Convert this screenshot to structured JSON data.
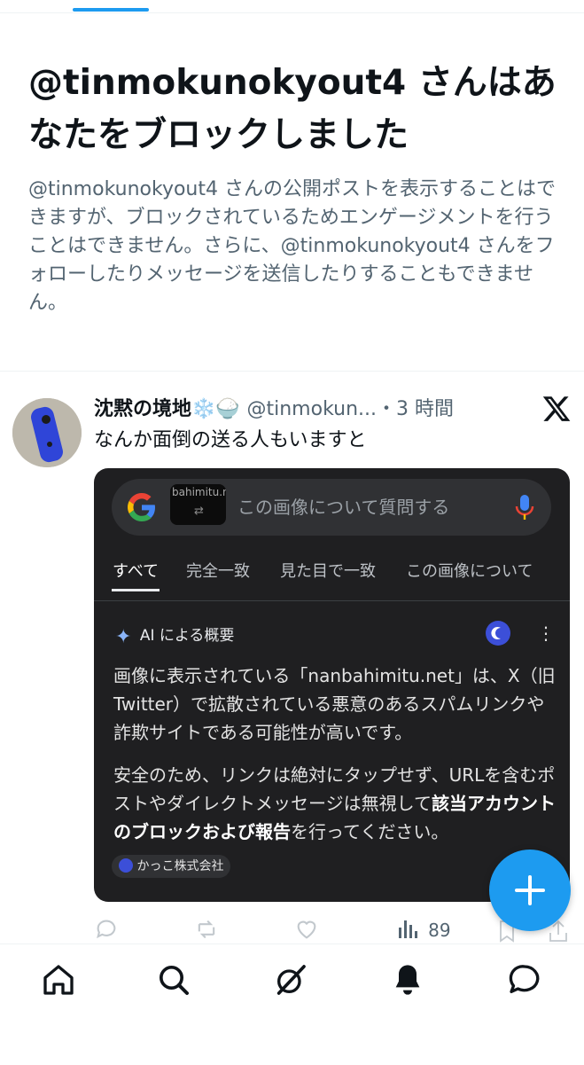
{
  "block_notice": {
    "title": "@tinmokunokyout4 さんはあなたをブロックしました",
    "description": "@tinmokunokyout4 さんの公開ポストを表示することはできますが、ブロックされているためエンゲージメントを行うことはできません。さらに、@tinmokunokyout4 さんをフォローしたりメッセージを送信したりすることもできません。"
  },
  "post": {
    "display_name": "沈黙の境地",
    "handle": "@tinmokun...",
    "time": "・3 時間",
    "text": "なんか面倒の送る人もいますと",
    "stats": {
      "views": "89"
    }
  },
  "google_card": {
    "thumbnail_text": "bahimitu.ne",
    "search_placeholder": "この画像について質問する",
    "tabs": [
      {
        "label": "すべて",
        "active": true
      },
      {
        "label": "完全一致",
        "active": false
      },
      {
        "label": "見た目で一致",
        "active": false
      },
      {
        "label": "この画像について",
        "active": false
      }
    ],
    "ai_overview_label": "AI による概要",
    "paragraph1": "画像に表示されている「nanbahimitu.net」は、X（旧Twitter）で拡散されている悪意のあるスパムリンクや詐欺サイトである可能性が高いです。",
    "paragraph2_start": "安全のため、リンクは絶対にタップせず、URLを含むポストやダイレクトメッセージは無視して",
    "paragraph2_bold": "該当アカウントのブロックおよび報告",
    "paragraph2_end": "を行ってください。",
    "source_chip": "かっこ株式会社"
  },
  "colors": {
    "accent": "#1d9bf0",
    "card_bg": "#1f1f21",
    "muted": "#536471"
  },
  "nav": [
    "home-icon",
    "search-icon",
    "grok-icon",
    "notifications-icon",
    "messages-icon"
  ]
}
